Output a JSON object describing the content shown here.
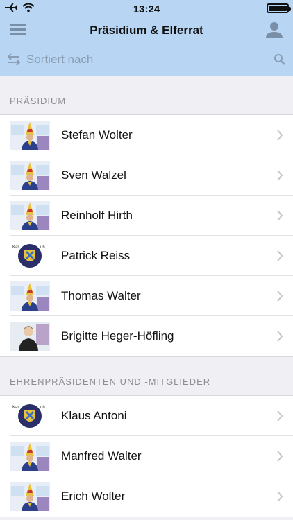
{
  "status_bar": {
    "time": "13:24"
  },
  "nav": {
    "title": "Präsidium & Elferrat"
  },
  "search": {
    "placeholder": "Sortiert nach"
  },
  "sections": [
    {
      "header": "PRÄSIDIUM",
      "items": [
        {
          "name": "Stefan Wolter",
          "avatar": "jester"
        },
        {
          "name": "Sven Walzel",
          "avatar": "jester"
        },
        {
          "name": "Reinholf Hirth",
          "avatar": "jester"
        },
        {
          "name": "Patrick Reiss",
          "avatar": "crest"
        },
        {
          "name": "Thomas Walter",
          "avatar": "jester"
        },
        {
          "name": "Brigitte Heger-Höfling",
          "avatar": "portrait"
        }
      ]
    },
    {
      "header": "EHRENPRÄSIDENTEN UND -MITGLIEDER",
      "items": [
        {
          "name": "Klaus Antoni",
          "avatar": "crest"
        },
        {
          "name": "Manfred Walter",
          "avatar": "jester"
        },
        {
          "name": "Erich Wolter",
          "avatar": "jester"
        }
      ]
    }
  ],
  "colors": {
    "header_bg": "#b8d6f3",
    "background": "#efeff4"
  }
}
